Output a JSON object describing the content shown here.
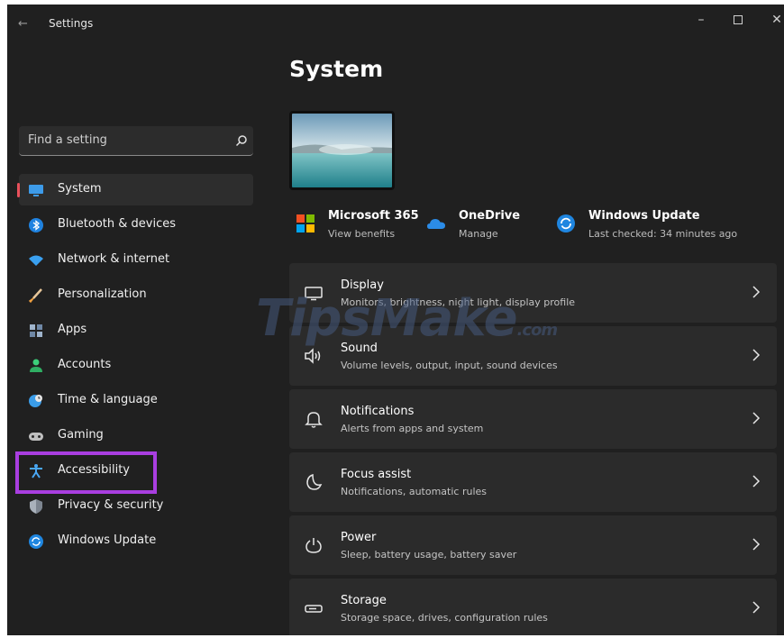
{
  "window": {
    "title": "Settings"
  },
  "search": {
    "placeholder": "Find a setting"
  },
  "sidebar": {
    "items": [
      {
        "label": "System",
        "icon": "monitor-icon",
        "selected": true
      },
      {
        "label": "Bluetooth & devices",
        "icon": "bluetooth-icon"
      },
      {
        "label": "Network & internet",
        "icon": "wifi-icon"
      },
      {
        "label": "Personalization",
        "icon": "brush-icon"
      },
      {
        "label": "Apps",
        "icon": "apps-icon"
      },
      {
        "label": "Accounts",
        "icon": "person-icon"
      },
      {
        "label": "Time & language",
        "icon": "globe-clock-icon"
      },
      {
        "label": "Gaming",
        "icon": "gamepad-icon"
      },
      {
        "label": "Accessibility",
        "icon": "accessibility-icon",
        "highlighted": true
      },
      {
        "label": "Privacy & security",
        "icon": "shield-icon"
      },
      {
        "label": "Windows Update",
        "icon": "update-icon"
      }
    ]
  },
  "main": {
    "title": "System",
    "quick_links": [
      {
        "title": "Microsoft 365",
        "subtitle": "View benefits",
        "icon": "microsoft-logo-icon"
      },
      {
        "title": "OneDrive",
        "subtitle": "Manage",
        "icon": "cloud-icon"
      },
      {
        "title": "Windows Update",
        "subtitle": "Last checked: 34 minutes ago",
        "icon": "update-icon"
      }
    ],
    "cards": [
      {
        "title": "Display",
        "subtitle": "Monitors, brightness, night light, display profile",
        "icon": "display-icon"
      },
      {
        "title": "Sound",
        "subtitle": "Volume levels, output, input, sound devices",
        "icon": "speaker-icon"
      },
      {
        "title": "Notifications",
        "subtitle": "Alerts from apps and system",
        "icon": "bell-icon"
      },
      {
        "title": "Focus assist",
        "subtitle": "Notifications, automatic rules",
        "icon": "moon-icon"
      },
      {
        "title": "Power",
        "subtitle": "Sleep, battery usage, battery saver",
        "icon": "power-icon"
      },
      {
        "title": "Storage",
        "subtitle": "Storage space, drives, configuration rules",
        "icon": "storage-icon"
      }
    ]
  },
  "watermark": {
    "text": "TipsMake",
    "suffix": ".com"
  },
  "colors": {
    "accent": "#4cc2ff",
    "selection_indicator": "#e8505b",
    "highlight_box": "#a93ee0",
    "background": "#202020",
    "card": "#2b2b2b"
  }
}
